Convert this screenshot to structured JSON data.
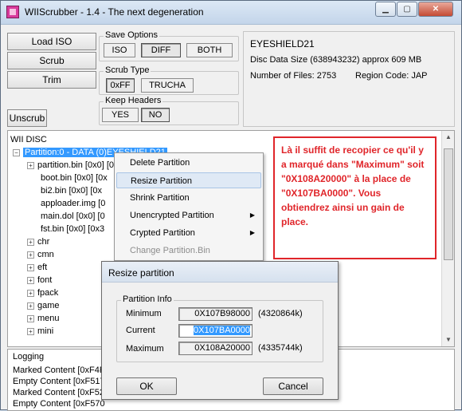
{
  "window": {
    "title": "WIIScrubber - 1.4 - The next degeneration"
  },
  "actions": {
    "load_iso": "Load ISO",
    "scrub": "Scrub",
    "trim": "Trim",
    "unscrub": "Unscrub"
  },
  "save_options": {
    "label": "Save Options",
    "iso": "ISO",
    "diff": "DIFF",
    "both": "BOTH",
    "selected": "DIFF"
  },
  "scrub_type": {
    "label": "Scrub Type",
    "hex_ff": "0xFF",
    "trucha": "TRUCHA",
    "selected": "0xFF"
  },
  "keep_headers": {
    "label": "Keep Headers",
    "yes": "YES",
    "no": "NO",
    "selected": "NO"
  },
  "disc_info": {
    "name": "EYESHIELD21",
    "size": "Disc Data Size (638943232) approx  609 MB",
    "files": "Number of Files: 2753",
    "region": "Region Code: JAP"
  },
  "tree": {
    "root": "WII DISC",
    "partition": "Partition:0 - DATA (0)EYESHIELD21",
    "files": [
      "partition.bin [0x0] [0x",
      "boot.bin [0x0] [0x",
      "bi2.bin [0x0] [0x",
      "apploader.img [0",
      "main.dol [0x0] [0",
      "fst.bin [0x0] [0x3"
    ],
    "folders": [
      "chr",
      "cmn",
      "eft",
      "font",
      "fpack",
      "game",
      "menu",
      "mini"
    ]
  },
  "context_menu": {
    "items": [
      {
        "label": "Delete Partition",
        "submenu": false,
        "disabled": false
      },
      {
        "label": "Resize Partition",
        "submenu": false,
        "disabled": false
      },
      {
        "label": "Shrink Partition",
        "submenu": false,
        "disabled": false
      },
      {
        "label": "Unencrypted Partition",
        "submenu": true,
        "disabled": false
      },
      {
        "label": "Crypted Partition",
        "submenu": true,
        "disabled": false
      },
      {
        "label": "Change Partition.Bin",
        "submenu": false,
        "disabled": true
      }
    ],
    "hovered": "Resize Partition"
  },
  "annotation": {
    "text": "Là il suffit de recopier ce qu'il y a marqué dans \"Maximum\" soit \"0X108A20000\" à la place de \"0X107BA0000\".  Vous obtiendrez ainsi un gain de place."
  },
  "logging": {
    "title": "Logging",
    "lines": [
      "Marked Content [0xF4F",
      "Empty Content [0xF517",
      "Marked Content [0xF52",
      "Empty Content [0xF570"
    ]
  },
  "dialog": {
    "title": "Resize partition",
    "group": "Partition Info",
    "minimum_label": "Minimum",
    "minimum_value": "0X107B98000",
    "minimum_kb": "(4320864k)",
    "current_label": "Current",
    "current_value": "0X107BA0000",
    "maximum_label": "Maximum",
    "maximum_value": "0X108A20000",
    "maximum_kb": "(4335744k)",
    "ok": "OK",
    "cancel": "Cancel"
  },
  "colors": {
    "annotation_red": "#e0252a",
    "selection_blue": "#3399ff"
  }
}
